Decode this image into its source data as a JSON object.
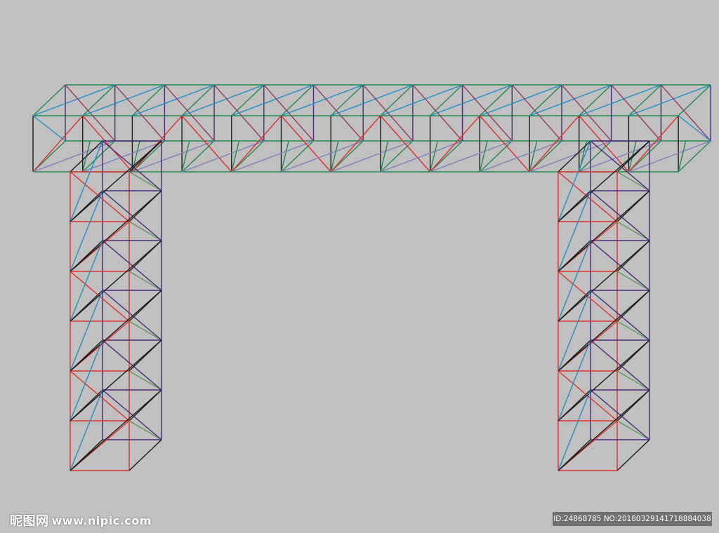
{
  "watermark": {
    "logo_cn": "昵图网",
    "logo_url": "www.nipic.com",
    "id_text": "ID:24868785 NO:20180329141718884038"
  },
  "colors": {
    "background": "#c0c0c0",
    "green": "#1f8a4c",
    "blue": "#1f8fc7",
    "red": "#e0302a",
    "purple": "#4a2a78",
    "magenta": "#9a3a6a",
    "black": "#1a1a1a",
    "lavender": "#7f7fc0",
    "light_green": "#5f9a5f"
  },
  "icons": {
    "truss_structure": "space-truss-gate-icon"
  }
}
